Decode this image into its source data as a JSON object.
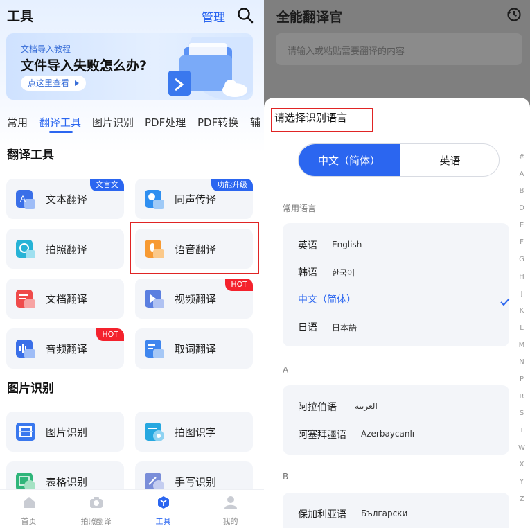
{
  "left": {
    "header": {
      "title": "工具",
      "manage_label": "管理",
      "search_icon": "search-icon"
    },
    "banner": {
      "subtitle": "文档导入教程",
      "title": "文件导入失败怎么办?",
      "button_label": "点这里查看"
    },
    "tabs": [
      {
        "label": "常用",
        "active": false
      },
      {
        "label": "翻译工具",
        "active": true
      },
      {
        "label": "图片识别",
        "active": false
      },
      {
        "label": "PDF处理",
        "active": false
      },
      {
        "label": "PDF转换",
        "active": false
      },
      {
        "label": "辅",
        "active": false
      }
    ],
    "section_translate": {
      "title": "翻译工具",
      "cards": [
        {
          "label": "文本翻译",
          "badge": "文言文",
          "badge_color": "#2b66f0",
          "icon": "text-translate-icon"
        },
        {
          "label": "同声传译",
          "badge": "功能升级",
          "badge_color": "#2b66f0",
          "icon": "simultaneous-interpret-icon"
        },
        {
          "label": "拍照翻译",
          "badge": "",
          "icon": "photo-translate-icon"
        },
        {
          "label": "语音翻译",
          "badge": "",
          "icon": "voice-translate-icon"
        },
        {
          "label": "文档翻译",
          "badge": "",
          "icon": "document-translate-icon"
        },
        {
          "label": "视频翻译",
          "badge": "HOT",
          "badge_color": "#f4222d",
          "icon": "video-translate-icon"
        },
        {
          "label": "音频翻译",
          "badge": "HOT",
          "badge_color": "#f4222d",
          "icon": "audio-translate-icon"
        },
        {
          "label": "取词翻译",
          "badge": "",
          "icon": "word-pick-translate-icon"
        }
      ]
    },
    "section_image": {
      "title": "图片识别",
      "cards": [
        {
          "label": "图片识别",
          "icon": "image-recognize-icon"
        },
        {
          "label": "拍图识字",
          "icon": "photo-ocr-icon"
        },
        {
          "label": "表格识别",
          "icon": "table-recognize-icon"
        },
        {
          "label": "手写识别",
          "icon": "handwriting-recognize-icon"
        }
      ]
    },
    "bottom_nav": [
      {
        "label": "首页",
        "active": false,
        "icon": "home-icon"
      },
      {
        "label": "拍照翻译",
        "active": false,
        "icon": "camera-icon"
      },
      {
        "label": "工具",
        "active": true,
        "icon": "tools-icon"
      },
      {
        "label": "我的",
        "active": false,
        "icon": "profile-icon"
      }
    ]
  },
  "right": {
    "title": "全能翻译官",
    "history_icon": "history-icon",
    "input_placeholder": "请输入或粘贴需要翻译的内容",
    "sheet": {
      "title": "请选择识别语言",
      "segment": {
        "left": "中文（简体）",
        "right": "英语",
        "selected": "left"
      },
      "common_header": "常用语言",
      "common": [
        {
          "name": "英语",
          "native": "English",
          "selected": false
        },
        {
          "name": "韩语",
          "native": "한국어",
          "selected": false
        },
        {
          "name": "中文（简体）",
          "native": "",
          "selected": true
        },
        {
          "name": "日语",
          "native": "日本語",
          "selected": false
        }
      ],
      "group_a_header": "A",
      "group_a": [
        {
          "name": "阿拉伯语",
          "native": "العربية"
        },
        {
          "name": "阿塞拜疆语",
          "native": "Azerbaycanlı"
        }
      ],
      "group_b_header": "B",
      "group_b": [
        {
          "name": "保加利亚语",
          "native": "Български"
        }
      ],
      "index_letters": [
        "#",
        "A",
        "B",
        "D",
        "E",
        "F",
        "G",
        "H",
        "J",
        "K",
        "L",
        "M",
        "N",
        "P",
        "R",
        "S",
        "T",
        "W",
        "X",
        "Y",
        "Z"
      ]
    }
  },
  "colors": {
    "accent": "#2b66f0",
    "hot": "#f4222d",
    "highlight_box": "#e02424"
  }
}
